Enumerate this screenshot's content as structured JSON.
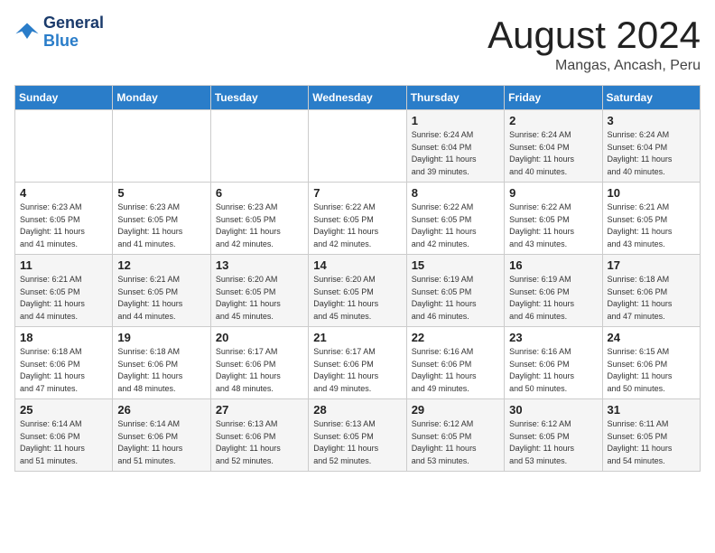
{
  "header": {
    "logo_line1": "General",
    "logo_line2": "Blue",
    "month": "August 2024",
    "location": "Mangas, Ancash, Peru"
  },
  "days_of_week": [
    "Sunday",
    "Monday",
    "Tuesday",
    "Wednesday",
    "Thursday",
    "Friday",
    "Saturday"
  ],
  "weeks": [
    [
      {
        "day": "",
        "info": ""
      },
      {
        "day": "",
        "info": ""
      },
      {
        "day": "",
        "info": ""
      },
      {
        "day": "",
        "info": ""
      },
      {
        "day": "1",
        "info": "Sunrise: 6:24 AM\nSunset: 6:04 PM\nDaylight: 11 hours\nand 39 minutes."
      },
      {
        "day": "2",
        "info": "Sunrise: 6:24 AM\nSunset: 6:04 PM\nDaylight: 11 hours\nand 40 minutes."
      },
      {
        "day": "3",
        "info": "Sunrise: 6:24 AM\nSunset: 6:04 PM\nDaylight: 11 hours\nand 40 minutes."
      }
    ],
    [
      {
        "day": "4",
        "info": "Sunrise: 6:23 AM\nSunset: 6:05 PM\nDaylight: 11 hours\nand 41 minutes."
      },
      {
        "day": "5",
        "info": "Sunrise: 6:23 AM\nSunset: 6:05 PM\nDaylight: 11 hours\nand 41 minutes."
      },
      {
        "day": "6",
        "info": "Sunrise: 6:23 AM\nSunset: 6:05 PM\nDaylight: 11 hours\nand 42 minutes."
      },
      {
        "day": "7",
        "info": "Sunrise: 6:22 AM\nSunset: 6:05 PM\nDaylight: 11 hours\nand 42 minutes."
      },
      {
        "day": "8",
        "info": "Sunrise: 6:22 AM\nSunset: 6:05 PM\nDaylight: 11 hours\nand 42 minutes."
      },
      {
        "day": "9",
        "info": "Sunrise: 6:22 AM\nSunset: 6:05 PM\nDaylight: 11 hours\nand 43 minutes."
      },
      {
        "day": "10",
        "info": "Sunrise: 6:21 AM\nSunset: 6:05 PM\nDaylight: 11 hours\nand 43 minutes."
      }
    ],
    [
      {
        "day": "11",
        "info": "Sunrise: 6:21 AM\nSunset: 6:05 PM\nDaylight: 11 hours\nand 44 minutes."
      },
      {
        "day": "12",
        "info": "Sunrise: 6:21 AM\nSunset: 6:05 PM\nDaylight: 11 hours\nand 44 minutes."
      },
      {
        "day": "13",
        "info": "Sunrise: 6:20 AM\nSunset: 6:05 PM\nDaylight: 11 hours\nand 45 minutes."
      },
      {
        "day": "14",
        "info": "Sunrise: 6:20 AM\nSunset: 6:05 PM\nDaylight: 11 hours\nand 45 minutes."
      },
      {
        "day": "15",
        "info": "Sunrise: 6:19 AM\nSunset: 6:05 PM\nDaylight: 11 hours\nand 46 minutes."
      },
      {
        "day": "16",
        "info": "Sunrise: 6:19 AM\nSunset: 6:06 PM\nDaylight: 11 hours\nand 46 minutes."
      },
      {
        "day": "17",
        "info": "Sunrise: 6:18 AM\nSunset: 6:06 PM\nDaylight: 11 hours\nand 47 minutes."
      }
    ],
    [
      {
        "day": "18",
        "info": "Sunrise: 6:18 AM\nSunset: 6:06 PM\nDaylight: 11 hours\nand 47 minutes."
      },
      {
        "day": "19",
        "info": "Sunrise: 6:18 AM\nSunset: 6:06 PM\nDaylight: 11 hours\nand 48 minutes."
      },
      {
        "day": "20",
        "info": "Sunrise: 6:17 AM\nSunset: 6:06 PM\nDaylight: 11 hours\nand 48 minutes."
      },
      {
        "day": "21",
        "info": "Sunrise: 6:17 AM\nSunset: 6:06 PM\nDaylight: 11 hours\nand 49 minutes."
      },
      {
        "day": "22",
        "info": "Sunrise: 6:16 AM\nSunset: 6:06 PM\nDaylight: 11 hours\nand 49 minutes."
      },
      {
        "day": "23",
        "info": "Sunrise: 6:16 AM\nSunset: 6:06 PM\nDaylight: 11 hours\nand 50 minutes."
      },
      {
        "day": "24",
        "info": "Sunrise: 6:15 AM\nSunset: 6:06 PM\nDaylight: 11 hours\nand 50 minutes."
      }
    ],
    [
      {
        "day": "25",
        "info": "Sunrise: 6:14 AM\nSunset: 6:06 PM\nDaylight: 11 hours\nand 51 minutes."
      },
      {
        "day": "26",
        "info": "Sunrise: 6:14 AM\nSunset: 6:06 PM\nDaylight: 11 hours\nand 51 minutes."
      },
      {
        "day": "27",
        "info": "Sunrise: 6:13 AM\nSunset: 6:06 PM\nDaylight: 11 hours\nand 52 minutes."
      },
      {
        "day": "28",
        "info": "Sunrise: 6:13 AM\nSunset: 6:05 PM\nDaylight: 11 hours\nand 52 minutes."
      },
      {
        "day": "29",
        "info": "Sunrise: 6:12 AM\nSunset: 6:05 PM\nDaylight: 11 hours\nand 53 minutes."
      },
      {
        "day": "30",
        "info": "Sunrise: 6:12 AM\nSunset: 6:05 PM\nDaylight: 11 hours\nand 53 minutes."
      },
      {
        "day": "31",
        "info": "Sunrise: 6:11 AM\nSunset: 6:05 PM\nDaylight: 11 hours\nand 54 minutes."
      }
    ]
  ]
}
